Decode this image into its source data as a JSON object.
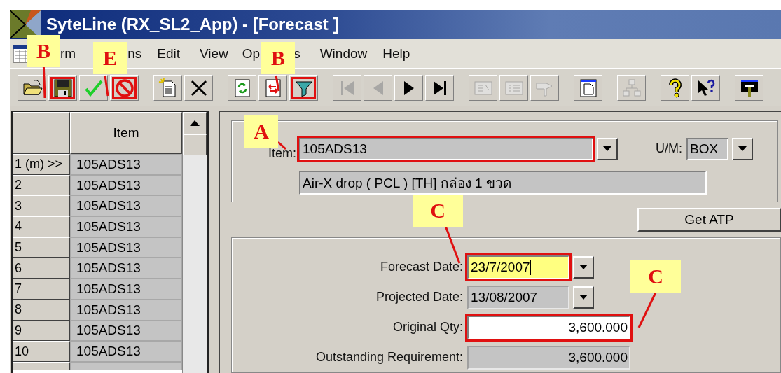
{
  "window": {
    "title": "SyteLine (RX_SL2_App) - [Forecast ]"
  },
  "menu": [
    {
      "label": "rm"
    },
    {
      "label": "ns"
    },
    {
      "label": "Edit"
    },
    {
      "label": "View"
    },
    {
      "label": "Op"
    },
    {
      "label": "s"
    },
    {
      "label": "Window"
    },
    {
      "label": "Help"
    }
  ],
  "toolbar": [
    {
      "kind": "open",
      "disabled": false,
      "highlighted": false
    },
    {
      "kind": "save",
      "disabled": false,
      "highlighted": true
    },
    {
      "kind": "check",
      "disabled": false,
      "highlighted": false
    },
    {
      "kind": "cancel",
      "disabled": false,
      "highlighted": true
    },
    {
      "kind": "new",
      "disabled": false,
      "highlighted": false
    },
    {
      "kind": "delete",
      "disabled": false,
      "highlighted": false
    },
    {
      "kind": "refresh",
      "disabled": false,
      "highlighted": false
    },
    {
      "kind": "filter-in-place",
      "disabled": false,
      "highlighted": false
    },
    {
      "kind": "filter",
      "disabled": false,
      "highlighted": true
    },
    {
      "kind": "first",
      "disabled": true,
      "highlighted": false
    },
    {
      "kind": "prev",
      "disabled": true,
      "highlighted": false
    },
    {
      "kind": "next",
      "disabled": false,
      "highlighted": false
    },
    {
      "kind": "last",
      "disabled": false,
      "highlighted": false
    },
    {
      "kind": "notes",
      "disabled": true,
      "highlighted": false
    },
    {
      "kind": "details",
      "disabled": true,
      "highlighted": false
    },
    {
      "kind": "drill",
      "disabled": true,
      "highlighted": false
    },
    {
      "kind": "page",
      "disabled": false,
      "highlighted": false
    },
    {
      "kind": "tree",
      "disabled": true,
      "highlighted": false
    },
    {
      "kind": "help",
      "disabled": false,
      "highlighted": false
    },
    {
      "kind": "whats-this",
      "disabled": false,
      "highlighted": false
    },
    {
      "kind": "tools",
      "disabled": false,
      "highlighted": false
    }
  ],
  "grid": {
    "columns": [
      "Item"
    ],
    "rows": [
      {
        "row_label": "1 (m) >>",
        "item": "105ADS13"
      },
      {
        "row_label": "2",
        "item": "105ADS13"
      },
      {
        "row_label": "3",
        "item": "105ADS13"
      },
      {
        "row_label": "4",
        "item": "105ADS13"
      },
      {
        "row_label": "5",
        "item": "105ADS13"
      },
      {
        "row_label": "6",
        "item": "105ADS13"
      },
      {
        "row_label": "7",
        "item": "105ADS13"
      },
      {
        "row_label": "8",
        "item": "105ADS13"
      },
      {
        "row_label": "9",
        "item": "105ADS13"
      },
      {
        "row_label": "10",
        "item": "105ADS13"
      }
    ]
  },
  "item_group": {
    "item_label": "Item:",
    "item_value": "105ADS13",
    "item_highlighted": true,
    "um_label": "U/M:",
    "um_value": "BOX",
    "description": "Air-X drop  ( PCL ) [TH]  กล่อง 1 ขวด"
  },
  "get_atp_button": {
    "label": "Get ATP"
  },
  "fields": [
    {
      "kind": "date",
      "label": "Forecast Date:",
      "value": "23/7/2007",
      "focused": true,
      "editable": true,
      "highlighted": true
    },
    {
      "kind": "date",
      "label": "Projected Date:",
      "value": "13/08/2007",
      "focused": false,
      "editable": false,
      "highlighted": false
    },
    {
      "kind": "number",
      "label": "Original Qty:",
      "value": "3,600.000",
      "focused": false,
      "editable": true,
      "highlighted": true
    },
    {
      "kind": "number",
      "label": "Outstanding Requirement:",
      "value": "3,600.000",
      "focused": false,
      "editable": false,
      "highlighted": false
    }
  ],
  "callouts": [
    {
      "label": "B"
    },
    {
      "label": "E"
    },
    {
      "label": "B"
    },
    {
      "label": "A"
    },
    {
      "label": "C"
    },
    {
      "label": "C"
    }
  ]
}
